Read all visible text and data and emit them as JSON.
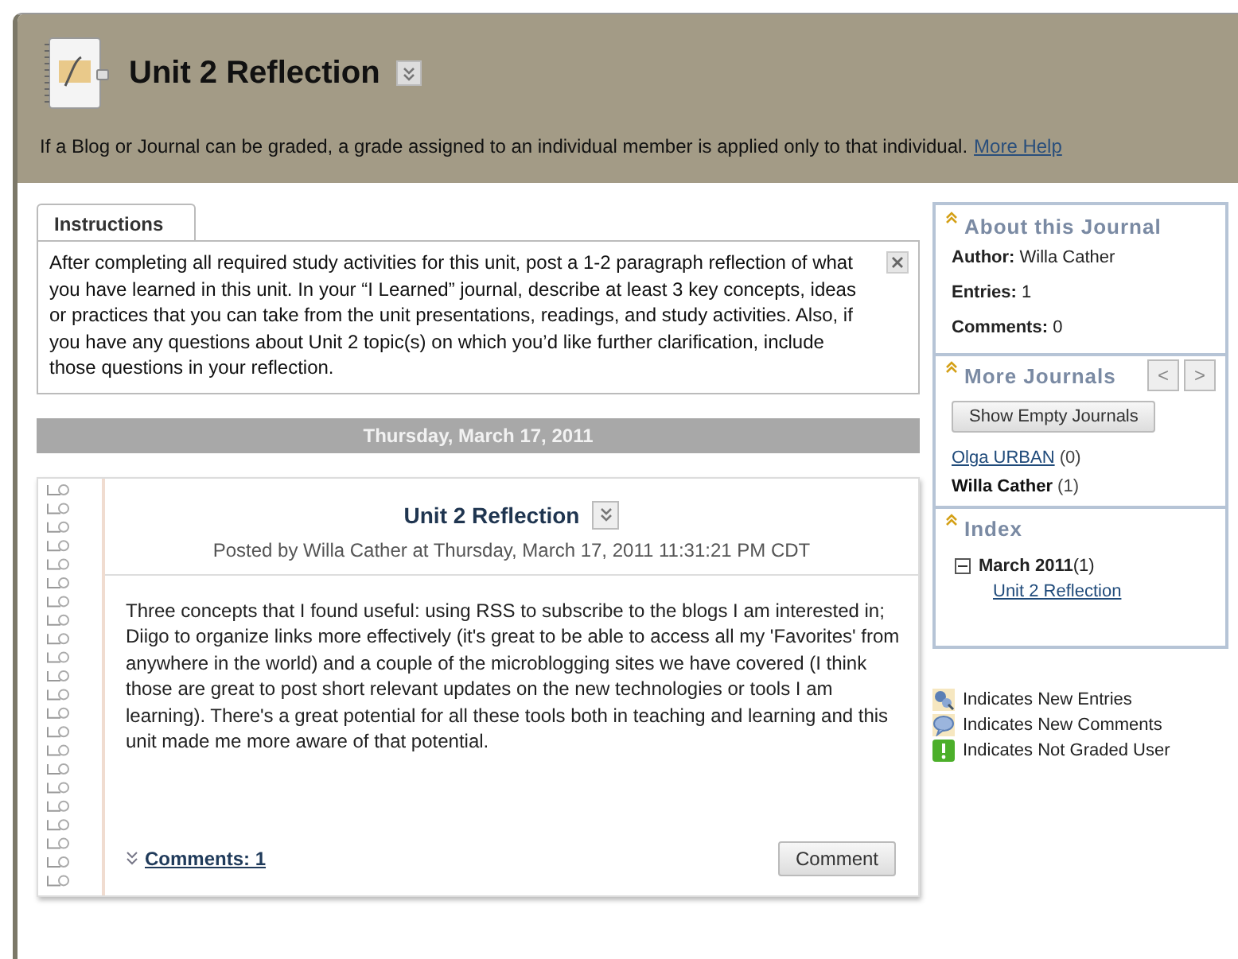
{
  "header": {
    "title": "Unit 2 Reflection",
    "help_text": "If a Blog or Journal can be graded, a grade assigned to an individual member is applied only to that individual.",
    "help_link": "More Help"
  },
  "instructions": {
    "tab": "Instructions",
    "text": "After completing all required study activities for this unit, post a 1-2 paragraph reflection of what you have learned in this unit. In your “I Learned” journal, describe at least 3 key concepts, ideas or practices that you can take from the unit presentations, readings, and study activities. Also, if you have any questions about Unit 2 topic(s) on which you’d like further clarification, include those questions in your reflection."
  },
  "date_bar": "Thursday, March 17, 2011",
  "entry": {
    "title": "Unit 2 Reflection",
    "posted": "Posted by Willa Cather at Thursday, March 17, 2011 11:31:21 PM CDT",
    "body": "Three concepts that I found useful: using RSS to subscribe to the blogs I am interested in; Diigo to organize links more effectively (it's great to be able to access all my 'Favorites' from anywhere in the world) and a couple of the microblogging sites we have covered (I think those are great to post short relevant updates on the new technologies or tools I am learning). There's a great potential for all these tools both in teaching and learning and this unit made me more aware of that potential.",
    "comments_link": "Comments: 1",
    "comment_button": "Comment"
  },
  "sidebar": {
    "about": {
      "title": "About this Journal",
      "fields": [
        {
          "label": "Author:",
          "value": "Willa Cather"
        },
        {
          "label": "Entries:",
          "value": "1"
        },
        {
          "label": "Comments:",
          "value": "0"
        }
      ]
    },
    "journals": {
      "title": "More Journals",
      "prev": "<",
      "next": ">",
      "show_empty": "Show Empty Journals",
      "items": [
        {
          "name": "Olga URBAN",
          "count": "(0)",
          "selected": false
        },
        {
          "name": "Willa Cather",
          "count": "(1)",
          "selected": true
        }
      ]
    },
    "index": {
      "title": "Index",
      "months": [
        {
          "label": "March 2011",
          "count": "(1)",
          "expanded": true,
          "children": [
            {
              "label": "Unit 2 Reflection"
            }
          ]
        }
      ]
    }
  },
  "legend": [
    {
      "kind": "entries",
      "label": "Indicates New Entries"
    },
    {
      "kind": "comments",
      "label": "Indicates New Comments"
    },
    {
      "kind": "notgraded",
      "label": "Indicates Not Graded User"
    }
  ]
}
